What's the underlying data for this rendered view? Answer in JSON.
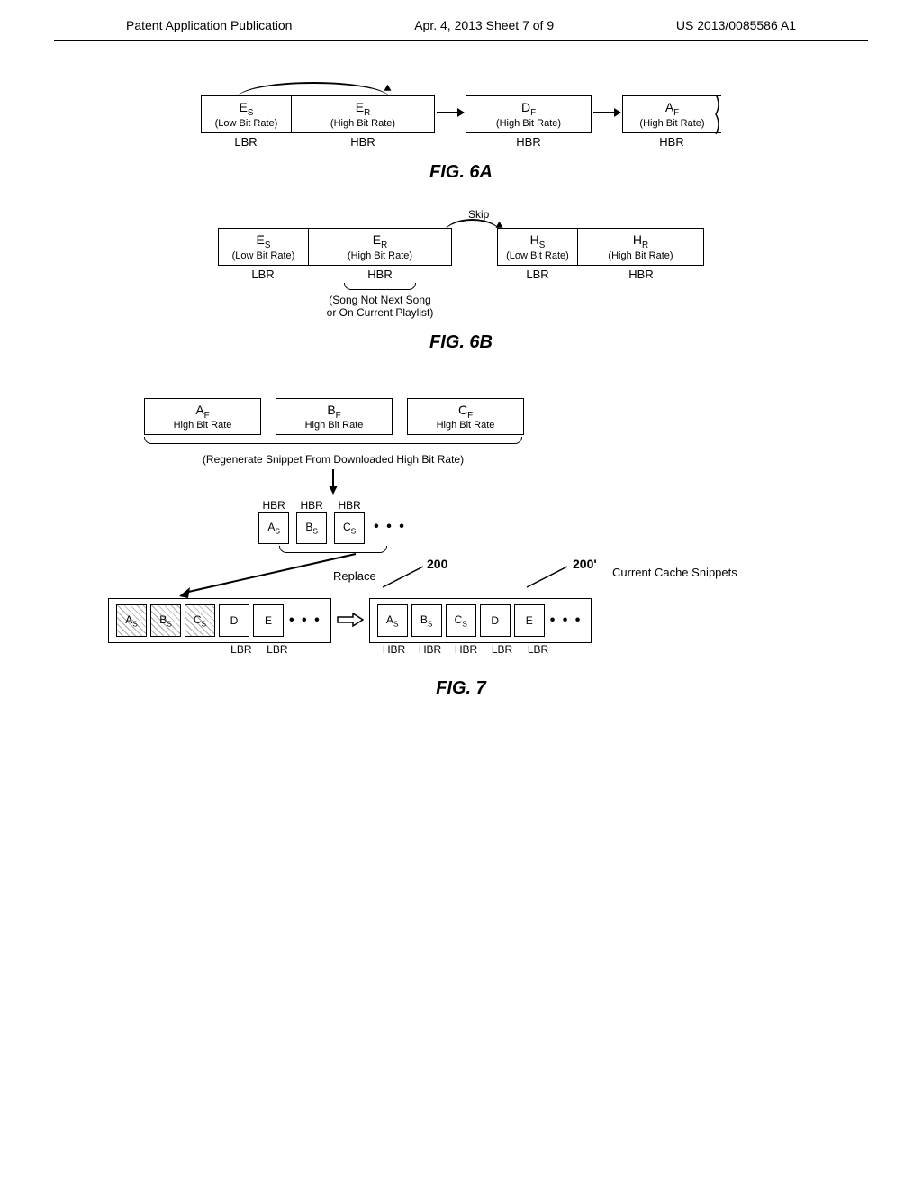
{
  "header": {
    "left": "Patent Application Publication",
    "center": "Apr. 4, 2013  Sheet 7 of 9",
    "right": "US 2013/0085586 A1"
  },
  "fig6a": {
    "title": "FIG. 6A",
    "b1": {
      "top": "E",
      "sub": "S",
      "bot": "(Low Bit Rate)",
      "below": "LBR"
    },
    "b2": {
      "top": "E",
      "sub": "R",
      "bot": "(High Bit Rate)",
      "below": "HBR"
    },
    "b3": {
      "top": "D",
      "sub": "F",
      "bot": "(High Bit Rate)",
      "below": "HBR"
    },
    "b4": {
      "top": "A",
      "sub": "F",
      "bot": "(High Bit Rate)",
      "below": "HBR"
    }
  },
  "fig6b": {
    "title": "FIG. 6B",
    "skip_label": "Skip",
    "b1": {
      "top": "E",
      "sub": "S",
      "bot": "(Low Bit Rate)",
      "below": "LBR"
    },
    "b2": {
      "top": "E",
      "sub": "R",
      "bot": "(High Bit Rate)",
      "below": "HBR"
    },
    "b3": {
      "top": "H",
      "sub": "S",
      "bot": "(Low Bit Rate)",
      "below": "LBR"
    },
    "b4": {
      "top": "H",
      "sub": "R",
      "bot": "(High Bit Rate)",
      "below": "HBR"
    },
    "note": "(Song Not Next Song or On Current Playlist)"
  },
  "fig7": {
    "title": "FIG. 7",
    "top": {
      "b1": {
        "top": "A",
        "sub": "F",
        "bot": "High Bit Rate"
      },
      "b2": {
        "top": "B",
        "sub": "F",
        "bot": "High Bit Rate"
      },
      "b3": {
        "top": "C",
        "sub": "F",
        "bot": "High Bit Rate"
      }
    },
    "regen_note": "(Regenerate Snippet From Downloaded High Bit Rate)",
    "mid_labels": {
      "hbr": "HBR"
    },
    "mid": {
      "b1": {
        "t": "A",
        "s": "S"
      },
      "b2": {
        "t": "B",
        "s": "S"
      },
      "b3": {
        "t": "C",
        "s": "S"
      },
      "dots": "• • •"
    },
    "replace_label": "Replace",
    "ref_200": "200",
    "ref_200p": "200'",
    "cache_label": "Current Cache Snippets",
    "left_box": {
      "b1": {
        "t": "A",
        "s": "S"
      },
      "b2": {
        "t": "B",
        "s": "S"
      },
      "b3": {
        "t": "C",
        "s": "S"
      },
      "b4": "D",
      "b5": "E",
      "dots": "• • •",
      "s4": "LBR",
      "s5": "LBR"
    },
    "right_box": {
      "b1": {
        "t": "A",
        "s": "S"
      },
      "b2": {
        "t": "B",
        "s": "S"
      },
      "b3": {
        "t": "C",
        "s": "S"
      },
      "b4": "D",
      "b5": "E",
      "dots": "• • •",
      "s1": "HBR",
      "s2": "HBR",
      "s3": "HBR",
      "s4": "LBR",
      "s5": "LBR"
    }
  }
}
